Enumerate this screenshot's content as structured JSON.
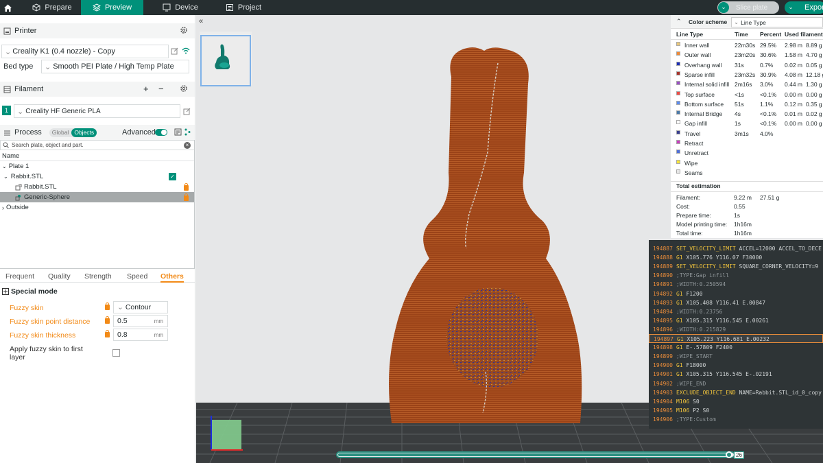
{
  "topbar": {
    "tabs": [
      {
        "label": "Prepare"
      },
      {
        "label": "Preview"
      },
      {
        "label": "Device"
      },
      {
        "label": "Project"
      }
    ],
    "slice_label": "Slice plate",
    "export_label": "Expor"
  },
  "printer": {
    "header": "Printer",
    "name": "Creality K1 (0.4 nozzle) - Copy",
    "bed_type_label": "Bed type",
    "bed_type_value": "Smooth PEI Plate / High Temp Plate"
  },
  "filament": {
    "header": "Filament",
    "slot": "1",
    "name": "Creality HF Generic PLA"
  },
  "process": {
    "header": "Process",
    "global_label": "Global",
    "objects_label": "Objects",
    "advanced_label": "Advanced",
    "search_placeholder": "Search plate, object and part."
  },
  "object_tree": {
    "name_header": "Name",
    "plate": "Plate 1",
    "object": "Rabbit.STL",
    "part": "Rabbit.STL",
    "modifier": "Generic-Sphere",
    "outside": "Outside"
  },
  "settings_tabs": [
    "Frequent",
    "Quality",
    "Strength",
    "Speed",
    "Others"
  ],
  "special_mode": {
    "title": "Special mode",
    "fuzzy_skin_label": "Fuzzy skin",
    "fuzzy_skin_value": "Contour",
    "point_distance_label": "Fuzzy skin point distance",
    "point_distance_value": "0.5",
    "thickness_label": "Fuzzy skin thickness",
    "thickness_value": "0.8",
    "unit": "mm",
    "first_layer_label_1": "Apply fuzzy skin to first",
    "first_layer_label_2": "layer"
  },
  "legend": {
    "color_scheme_label": "Color scheme",
    "color_scheme_value": "Line Type",
    "headers": {
      "type": "Line Type",
      "time": "Time",
      "percent": "Percent",
      "used": "Used filament"
    },
    "rows": [
      {
        "name": "Inner wall",
        "time": "22m30s",
        "percent": "29.5%",
        "len": "2.98 m",
        "g": "8.89 g",
        "color": "#e8c77a"
      },
      {
        "name": "Outer wall",
        "time": "23m20s",
        "percent": "30.6%",
        "len": "1.58 m",
        "g": "4.70 g",
        "color": "#ef8a37"
      },
      {
        "name": "Overhang wall",
        "time": "31s",
        "percent": "0.7%",
        "len": "0.02 m",
        "g": "0.05 g",
        "color": "#1d2fb5"
      },
      {
        "name": "Sparse infill",
        "time": "23m32s",
        "percent": "30.9%",
        "len": "4.08 m",
        "g": "12.18 g",
        "color": "#a7342b"
      },
      {
        "name": "Internal solid infill",
        "time": "2m16s",
        "percent": "3.0%",
        "len": "0.44 m",
        "g": "1.30 g",
        "color": "#9a4fc4"
      },
      {
        "name": "Top surface",
        "time": "<1s",
        "percent": "<0.1%",
        "len": "0.00 m",
        "g": "0.00 g",
        "color": "#ee4b45"
      },
      {
        "name": "Bottom surface",
        "time": "51s",
        "percent": "1.1%",
        "len": "0.12 m",
        "g": "0.35 g",
        "color": "#5c8cf0"
      },
      {
        "name": "Internal Bridge",
        "time": "4s",
        "percent": "<0.1%",
        "len": "0.01 m",
        "g": "0.02 g",
        "color": "#4b7aa8"
      },
      {
        "name": "Gap infill",
        "time": "1s",
        "percent": "<0.1%",
        "len": "0.00 m",
        "g": "0.00 g",
        "color": "#ffffff"
      },
      {
        "name": "Travel",
        "time": "3m1s",
        "percent": "4.0%",
        "len": "",
        "g": "",
        "color": "#3a3f8f"
      },
      {
        "name": "Retract",
        "time": "",
        "percent": "",
        "len": "",
        "g": "",
        "color": "#c83fbf"
      },
      {
        "name": "Unretract",
        "time": "",
        "percent": "",
        "len": "",
        "g": "",
        "color": "#4f6fd8"
      },
      {
        "name": "Wipe",
        "time": "",
        "percent": "",
        "len": "",
        "g": "",
        "color": "#f6e43a"
      },
      {
        "name": "Seams",
        "time": "",
        "percent": "",
        "len": "",
        "g": "",
        "color": "#e6e6e6"
      }
    ],
    "total_title": "Total estimation",
    "totals": [
      {
        "label": "Filament:",
        "value": "9.22 m",
        "extra": "27.51 g"
      },
      {
        "label": "Cost:",
        "value": "0.55",
        "extra": ""
      },
      {
        "label": "Prepare time:",
        "value": "1s",
        "extra": ""
      },
      {
        "label": "Model printing time:",
        "value": "1h16m",
        "extra": ""
      },
      {
        "label": "Total time:",
        "value": "1h16m",
        "extra": ""
      }
    ]
  },
  "gcode": [
    {
      "ln": "194887",
      "cmd": "SET_VELOCITY_LIMIT",
      "rest": " ACCEL=12000 ACCEL_TO_DECE"
    },
    {
      "ln": "194888",
      "cmd": "G1",
      "rest": " X105.776 Y116.07 F30000"
    },
    {
      "ln": "194889",
      "cmd": "SET_VELOCITY_LIMIT",
      "rest": " SQUARE_CORNER_VELOCITY=9"
    },
    {
      "ln": "194890",
      "cmd": "",
      "rest": ";TYPE:Gap infill"
    },
    {
      "ln": "194891",
      "cmd": "",
      "rest": ";WIDTH:0.250594"
    },
    {
      "ln": "194892",
      "cmd": "G1",
      "rest": " F1200"
    },
    {
      "ln": "194893",
      "cmd": "G1",
      "rest": " X105.408 Y116.41 E.00847"
    },
    {
      "ln": "194894",
      "cmd": "",
      "rest": ";WIDTH:0.23756"
    },
    {
      "ln": "194895",
      "cmd": "G1",
      "rest": " X105.315 Y116.545 E.00261"
    },
    {
      "ln": "194896",
      "cmd": "",
      "rest": ";WIDTH:0.215829"
    },
    {
      "ln": "194897",
      "cmd": "G1",
      "rest": " X105.223 Y116.681 E.00232"
    },
    {
      "ln": "194898",
      "cmd": "G1",
      "rest": " E-.57809 F2400"
    },
    {
      "ln": "194899",
      "cmd": "",
      "rest": ";WIPE_START"
    },
    {
      "ln": "194900",
      "cmd": "G1",
      "rest": " F18000"
    },
    {
      "ln": "194901",
      "cmd": "G1",
      "rest": " X105.315 Y116.545 E-.02191"
    },
    {
      "ln": "194902",
      "cmd": "",
      "rest": ";WIPE_END"
    },
    {
      "ln": "194903",
      "cmd": "EXCLUDE_OBJECT_END",
      "rest": " NAME=Rabbit.STL_id_0_copy"
    },
    {
      "ln": "194904",
      "cmd": "M106",
      "rest": " S0"
    },
    {
      "ln": "194905",
      "cmd": "M106",
      "rest": " P2 S0"
    },
    {
      "ln": "194906",
      "cmd": "",
      "rest": ";TYPE:Custom"
    }
  ],
  "layer_slider": {
    "value_label": "26",
    "position": 0.99
  },
  "colors": {
    "accent": "#00917a",
    "topbar": "#262e30",
    "orange": "#f28a17",
    "model": "#a0451d"
  }
}
